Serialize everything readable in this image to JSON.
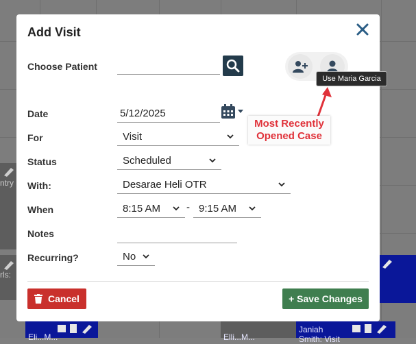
{
  "modal": {
    "title": "Add Visit",
    "close_icon": "close-icon"
  },
  "form": {
    "choose_patient_label": "Choose Patient",
    "patient_value": "",
    "date_label": "Date",
    "date_value": "5/12/2025",
    "for_label": "For",
    "for_value": "Visit",
    "status_label": "Status",
    "status_value": "Scheduled",
    "with_label": "With:",
    "with_value": "Desarae Heli OTR",
    "when_label": "When",
    "when_start": "8:15 AM",
    "when_separator": "-",
    "when_end": "9:15 AM",
    "notes_label": "Notes",
    "notes_value": "",
    "recurring_label": "Recurring?",
    "recurring_value": "No"
  },
  "tooltip": {
    "text": "Use Maria Garcia"
  },
  "annotation": {
    "line1": "Most Recently",
    "line2": "Opened Case",
    "color": "#e0323a"
  },
  "footer": {
    "cancel_label": "Cancel",
    "save_label": "+ Save Changes"
  },
  "background": {
    "block_labels": [
      "Janiah",
      "Smith: Visit",
      "ntry",
      "rls:",
      "Eli...M...",
      "Elli...M..."
    ]
  },
  "colors": {
    "search_button": "#233b4b",
    "cancel_button": "#c9302c",
    "save_button": "#3f7e4f",
    "calendar_block": "#0a1799"
  },
  "icons": [
    "close-icon",
    "search-icon",
    "add-person-icon",
    "person-icon",
    "calendar-icon",
    "trash-icon",
    "pencil-icon",
    "clipboard-icon"
  ]
}
